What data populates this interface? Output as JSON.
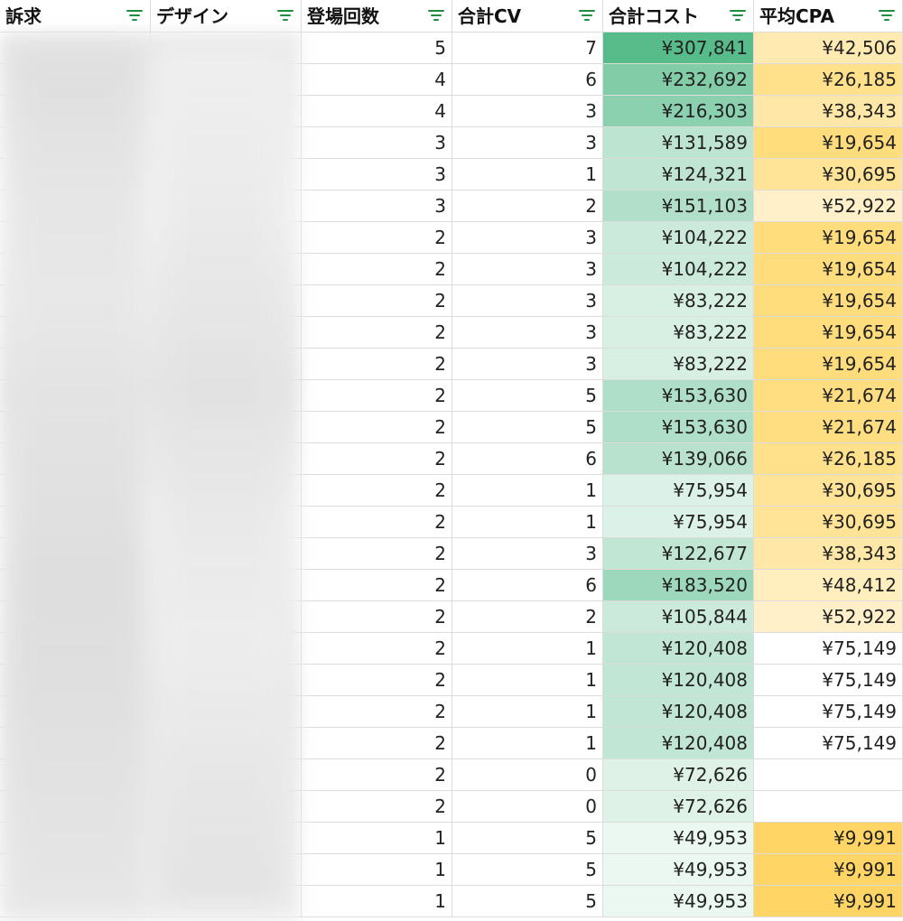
{
  "headers": [
    {
      "label": "訴求"
    },
    {
      "label": "デザイン"
    },
    {
      "label": "登場回数"
    },
    {
      "label": "合計CV"
    },
    {
      "label": "合計コスト"
    },
    {
      "label": "平均CPA"
    }
  ],
  "colors": {
    "filter_icon": "#1e8e3e",
    "cost_scale_high": "#57bb8a",
    "cost_scale_low": "#ffffff",
    "cpa_scale_high": "#ffd666",
    "cpa_scale_low": "#ffffff"
  },
  "rows": [
    {
      "count": "5",
      "cv": "7",
      "cost": "¥307,841",
      "cpa": "¥42,506"
    },
    {
      "count": "4",
      "cv": "6",
      "cost": "¥232,692",
      "cpa": "¥26,185"
    },
    {
      "count": "4",
      "cv": "3",
      "cost": "¥216,303",
      "cpa": "¥38,343"
    },
    {
      "count": "3",
      "cv": "3",
      "cost": "¥131,589",
      "cpa": "¥19,654"
    },
    {
      "count": "3",
      "cv": "1",
      "cost": "¥124,321",
      "cpa": "¥30,695"
    },
    {
      "count": "3",
      "cv": "2",
      "cost": "¥151,103",
      "cpa": "¥52,922"
    },
    {
      "count": "2",
      "cv": "3",
      "cost": "¥104,222",
      "cpa": "¥19,654"
    },
    {
      "count": "2",
      "cv": "3",
      "cost": "¥104,222",
      "cpa": "¥19,654"
    },
    {
      "count": "2",
      "cv": "3",
      "cost": "¥83,222",
      "cpa": "¥19,654"
    },
    {
      "count": "2",
      "cv": "3",
      "cost": "¥83,222",
      "cpa": "¥19,654"
    },
    {
      "count": "2",
      "cv": "3",
      "cost": "¥83,222",
      "cpa": "¥19,654"
    },
    {
      "count": "2",
      "cv": "5",
      "cost": "¥153,630",
      "cpa": "¥21,674"
    },
    {
      "count": "2",
      "cv": "5",
      "cost": "¥153,630",
      "cpa": "¥21,674"
    },
    {
      "count": "2",
      "cv": "6",
      "cost": "¥139,066",
      "cpa": "¥26,185"
    },
    {
      "count": "2",
      "cv": "1",
      "cost": "¥75,954",
      "cpa": "¥30,695"
    },
    {
      "count": "2",
      "cv": "1",
      "cost": "¥75,954",
      "cpa": "¥30,695"
    },
    {
      "count": "2",
      "cv": "3",
      "cost": "¥122,677",
      "cpa": "¥38,343"
    },
    {
      "count": "2",
      "cv": "6",
      "cost": "¥183,520",
      "cpa": "¥48,412"
    },
    {
      "count": "2",
      "cv": "2",
      "cost": "¥105,844",
      "cpa": "¥52,922"
    },
    {
      "count": "2",
      "cv": "1",
      "cost": "¥120,408",
      "cpa": "¥75,149"
    },
    {
      "count": "2",
      "cv": "1",
      "cost": "¥120,408",
      "cpa": "¥75,149"
    },
    {
      "count": "2",
      "cv": "1",
      "cost": "¥120,408",
      "cpa": "¥75,149"
    },
    {
      "count": "2",
      "cv": "1",
      "cost": "¥120,408",
      "cpa": "¥75,149"
    },
    {
      "count": "2",
      "cv": "0",
      "cost": "¥72,626",
      "cpa": ""
    },
    {
      "count": "2",
      "cv": "0",
      "cost": "¥72,626",
      "cpa": ""
    },
    {
      "count": "1",
      "cv": "5",
      "cost": "¥49,953",
      "cpa": "¥9,991"
    },
    {
      "count": "1",
      "cv": "5",
      "cost": "¥49,953",
      "cpa": "¥9,991"
    },
    {
      "count": "1",
      "cv": "5",
      "cost": "¥49,953",
      "cpa": "¥9,991"
    }
  ]
}
